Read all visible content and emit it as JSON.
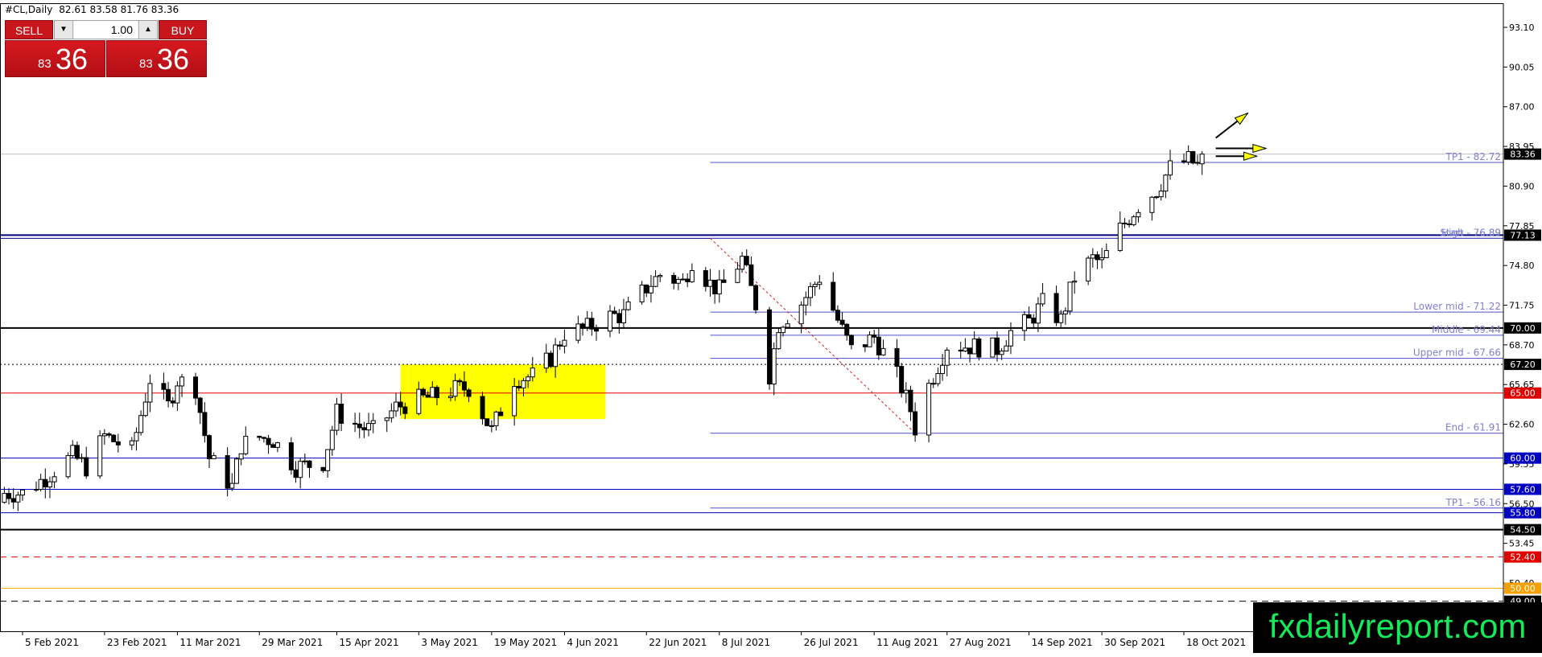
{
  "header": {
    "symbol": "#CL,Daily",
    "ohlc": "82.61 83.58 81.76 83.36"
  },
  "trade_panel": {
    "sell_label": "SELL",
    "buy_label": "BUY",
    "lot": "1.00",
    "sell_price_small": "83",
    "sell_price_big": "36",
    "buy_price_small": "83",
    "buy_price_big": "36",
    "down_icon": "caret-down-icon",
    "up_icon": "caret-up-icon"
  },
  "brand": "fxdailyreport.com",
  "chart_data": {
    "type": "candlestick",
    "instrument": "#CL",
    "timeframe": "Daily",
    "ylim": [
      48.1,
      94.8
    ],
    "y_ticks": [
      "93.10",
      "90.05",
      "87.00",
      "83.95",
      "80.90",
      "77.85",
      "74.80",
      "71.75",
      "68.70",
      "65.65",
      "62.60",
      "59.55",
      "56.50",
      "53.45",
      "50.40"
    ],
    "x_ticks": [
      {
        "label": "5 Feb 2021",
        "date": "2021-02-05"
      },
      {
        "label": "23 Feb 2021",
        "date": "2021-02-23"
      },
      {
        "label": "11 Mar 2021",
        "date": "2021-03-11"
      },
      {
        "label": "29 Mar 2021",
        "date": "2021-03-29"
      },
      {
        "label": "15 Apr 2021",
        "date": "2021-04-15"
      },
      {
        "label": "3 May 2021",
        "date": "2021-05-03"
      },
      {
        "label": "19 May 2021",
        "date": "2021-05-19"
      },
      {
        "label": "4 Jun 2021",
        "date": "2021-06-04"
      },
      {
        "label": "22 Jun 2021",
        "date": "2021-06-22"
      },
      {
        "label": "8 Jul 2021",
        "date": "2021-07-08"
      },
      {
        "label": "26 Jul 2021",
        "date": "2021-07-26"
      },
      {
        "label": "11 Aug 2021",
        "date": "2021-08-11"
      },
      {
        "label": "27 Aug 2021",
        "date": "2021-08-27"
      },
      {
        "label": "14 Sep 2021",
        "date": "2021-09-14"
      },
      {
        "label": "30 Sep 2021",
        "date": "2021-09-30"
      },
      {
        "label": "18 Oct 2021",
        "date": "2021-10-18"
      }
    ],
    "close_path": [
      [
        "2021-02-05",
        57.3
      ],
      [
        "2021-02-10",
        58.5
      ],
      [
        "2021-02-16",
        60.2
      ],
      [
        "2021-02-19",
        59.3
      ],
      [
        "2021-02-23",
        61.7
      ],
      [
        "2021-03-01",
        60.6
      ],
      [
        "2021-03-05",
        66.1
      ],
      [
        "2021-03-09",
        64.0
      ],
      [
        "2021-03-11",
        66.0
      ],
      [
        "2021-03-15",
        65.4
      ],
      [
        "2021-03-18",
        60.0
      ],
      [
        "2021-03-23",
        57.8
      ],
      [
        "2021-03-25",
        61.0
      ],
      [
        "2021-03-29",
        61.6
      ],
      [
        "2021-04-01",
        61.4
      ],
      [
        "2021-04-06",
        59.3
      ],
      [
        "2021-04-12",
        59.7
      ],
      [
        "2021-04-15",
        63.5
      ],
      [
        "2021-04-20",
        62.4
      ],
      [
        "2021-04-23",
        62.1
      ],
      [
        "2021-04-28",
        63.9
      ],
      [
        "2021-05-03",
        64.5
      ],
      [
        "2021-05-06",
        64.7
      ],
      [
        "2021-05-11",
        65.3
      ],
      [
        "2021-05-14",
        65.4
      ],
      [
        "2021-05-19",
        62.1
      ],
      [
        "2021-05-24",
        66.1
      ],
      [
        "2021-05-28",
        66.3
      ],
      [
        "2021-06-01",
        67.7
      ],
      [
        "2021-06-04",
        69.6
      ],
      [
        "2021-06-09",
        70.0
      ],
      [
        "2021-06-14",
        70.9
      ],
      [
        "2021-06-17",
        71.0
      ],
      [
        "2021-06-22",
        73.1
      ],
      [
        "2021-06-25",
        74.1
      ],
      [
        "2021-06-30",
        73.5
      ],
      [
        "2021-07-02",
        75.2
      ],
      [
        "2021-07-06",
        73.4
      ],
      [
        "2021-07-08",
        72.9
      ],
      [
        "2021-07-13",
        75.3
      ],
      [
        "2021-07-16",
        71.8
      ],
      [
        "2021-07-19",
        66.4
      ],
      [
        "2021-07-21",
        70.3
      ],
      [
        "2021-07-26",
        71.9
      ],
      [
        "2021-07-30",
        73.9
      ],
      [
        "2021-08-03",
        70.6
      ],
      [
        "2021-08-06",
        68.3
      ],
      [
        "2021-08-11",
        69.3
      ],
      [
        "2021-08-16",
        66.3
      ],
      [
        "2021-08-19",
        63.7
      ],
      [
        "2021-08-20",
        62.3
      ],
      [
        "2021-08-23",
        65.6
      ],
      [
        "2021-08-27",
        68.7
      ],
      [
        "2021-09-01",
        68.6
      ],
      [
        "2021-09-07",
        68.4
      ],
      [
        "2021-09-10",
        69.7
      ],
      [
        "2021-09-14",
        70.5
      ],
      [
        "2021-09-17",
        71.9
      ],
      [
        "2021-09-21",
        70.6
      ],
      [
        "2021-09-24",
        73.9
      ],
      [
        "2021-09-28",
        75.3
      ],
      [
        "2021-09-30",
        75.0
      ],
      [
        "2021-10-04",
        77.6
      ],
      [
        "2021-10-08",
        79.4
      ],
      [
        "2021-10-12",
        80.6
      ],
      [
        "2021-10-15",
        82.3
      ],
      [
        "2021-10-19",
        82.9
      ],
      [
        "2021-10-21",
        82.5
      ],
      [
        "2021-10-22",
        83.36
      ]
    ],
    "last_candle": {
      "date": "2021-10-22",
      "open": 82.61,
      "high": 83.58,
      "low": 81.76,
      "close": 83.36
    },
    "levels": [
      {
        "value": 83.36,
        "label": "83.36",
        "color": "#c0c0c0",
        "dash": "none",
        "tag_bg": "#000000",
        "tag_fg": "#ffffff"
      },
      {
        "value": 77.13,
        "label": "77.13",
        "color": "#000080",
        "dash": "none",
        "tag_bg": "#000000",
        "tag_fg": "#ffffff"
      },
      {
        "value": 76.89,
        "color": "#000080",
        "dash": "none"
      },
      {
        "value": 70.0,
        "label": "70.00",
        "color": "#000000",
        "dash": "none",
        "tag_bg": "#000000",
        "tag_fg": "#ffffff"
      },
      {
        "value": 67.2,
        "label": "67.20",
        "color": "#000000",
        "dash": "2,3",
        "tag_bg": "#000000",
        "tag_fg": "#ffffff"
      },
      {
        "value": 65.0,
        "label": "65.00",
        "color": "#e00000",
        "dash": "none",
        "tag_bg": "#e00000",
        "tag_fg": "#ffffff"
      },
      {
        "value": 60.0,
        "label": "60.00",
        "color": "#0000c0",
        "dash": "none",
        "tag_bg": "#0000c0",
        "tag_fg": "#ffffff"
      },
      {
        "value": 57.6,
        "label": "57.60",
        "color": "#0000c0",
        "dash": "none",
        "tag_bg": "#0000c0",
        "tag_fg": "#ffffff"
      },
      {
        "value": 55.8,
        "label": "55.80",
        "color": "#0000c0",
        "dash": "none",
        "tag_bg": "#0000c0",
        "tag_fg": "#ffffff"
      },
      {
        "value": 54.5,
        "label": "54.50",
        "color": "#000000",
        "dash": "none",
        "tag_bg": "#000000",
        "tag_fg": "#ffffff"
      },
      {
        "value": 52.4,
        "label": "52.40",
        "color": "#e00000",
        "dash": "8,6",
        "tag_bg": "#e00000",
        "tag_fg": "#ffffff"
      },
      {
        "value": 50.0,
        "label": "50.00",
        "color": "#f0b000",
        "dash": "none",
        "tag_bg": "#f5a000",
        "tag_fg": "#ffffff"
      },
      {
        "value": 49.0,
        "label": "49.00",
        "color": "#000000",
        "dash": "8,6",
        "tag_bg": "#000000",
        "tag_fg": "#ffffff"
      }
    ],
    "fib_levels": [
      {
        "label": "TP1 - 82.72",
        "value": 82.72
      },
      {
        "label": "Start - 76.89",
        "value": 76.89
      },
      {
        "label": "High - 76.89",
        "value": 76.89
      },
      {
        "label": "Lower mid - 71.22",
        "value": 71.22
      },
      {
        "label": "Middle - 69.44",
        "value": 69.44
      },
      {
        "label": "Upper mid - 67.66",
        "value": 67.66
      },
      {
        "label": "End - 61.91",
        "value": 61.91
      },
      {
        "label": "TP1 - 56.16",
        "value": 56.16
      }
    ],
    "fib_color": "#5050c8",
    "fib_label_color": "#8080d0",
    "fib_from_date": "2021-07-06",
    "trend_line": {
      "from_date": "2021-07-06",
      "from_value": 76.89,
      "to_date": "2021-08-20",
      "to_value": 61.91,
      "color": "#d02020"
    },
    "zone": {
      "from_date": "2021-04-29",
      "to_date": "2021-06-13",
      "top": 67.2,
      "bottom": 63.0,
      "color": "#ffff00"
    },
    "arrows": [
      {
        "from_date": "2021-10-25",
        "from_value": 84.6,
        "to_date": "2021-11-01",
        "to_value": 86.5
      },
      {
        "from_date": "2021-10-25",
        "from_value": 83.8,
        "to_date": "2021-11-05",
        "to_value": 83.8
      },
      {
        "from_date": "2021-10-25",
        "from_value": 83.2,
        "to_date": "2021-11-03",
        "to_value": 83.2
      }
    ],
    "colors": {
      "up_body": "#ffffff",
      "down_body": "#000000",
      "wick": "#000000",
      "axis": "#000000",
      "arrow_fill": "#ffff00"
    }
  }
}
